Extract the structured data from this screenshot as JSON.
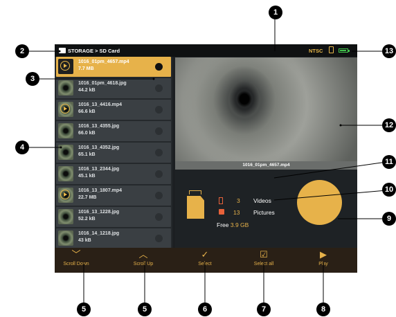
{
  "statusbar": {
    "path": "STORAGE > SD Card",
    "video_mode": "NTSC"
  },
  "files": [
    {
      "name": "1016_01pm_4657.mp4",
      "size": "7.7 MB",
      "video": true,
      "selected": true
    },
    {
      "name": "1016_01pm_4618.jpg",
      "size": "44.2 kB",
      "video": false,
      "selected": false
    },
    {
      "name": "1016_13_4416.mp4",
      "size": "66.6 kB",
      "video": true,
      "selected": false
    },
    {
      "name": "1016_13_4355.jpg",
      "size": "66.0 kB",
      "video": false,
      "selected": false
    },
    {
      "name": "1016_13_4352.jpg",
      "size": "65.1 kB",
      "video": false,
      "selected": false
    },
    {
      "name": "1016_13_2344.jpg",
      "size": "45.1 kB",
      "video": false,
      "selected": false
    },
    {
      "name": "1016_13_1807.mp4",
      "size": "22.7 MB",
      "video": true,
      "selected": false
    },
    {
      "name": "1016_13_1228.jpg",
      "size": "52.2 kB",
      "video": false,
      "selected": false
    },
    {
      "name": "1016_14_1218.jpg",
      "size": "43 kB",
      "video": false,
      "selected": false
    }
  ],
  "preview": {
    "caption": "1016_01pm_4657.mp4"
  },
  "storage": {
    "videos_count": "3",
    "videos_label": "Videos",
    "pictures_count": "13",
    "pictures_label": "Pictures",
    "free_label": "Free",
    "free_value": "3.9 GB"
  },
  "toolbar": {
    "scroll_down": "Scroll Down",
    "scroll_up": "Scroll Up",
    "select": "Select",
    "select_all": "Select all",
    "play": "Play"
  },
  "callouts": [
    "1",
    "2",
    "3",
    "4",
    "5",
    "5",
    "6",
    "7",
    "8",
    "9",
    "10",
    "11",
    "12",
    "13"
  ],
  "colors": {
    "accent": "#e7b24a",
    "screen_bg": "#1c1f22",
    "icon_red": "#e8623a",
    "battery": "#42c24d"
  }
}
